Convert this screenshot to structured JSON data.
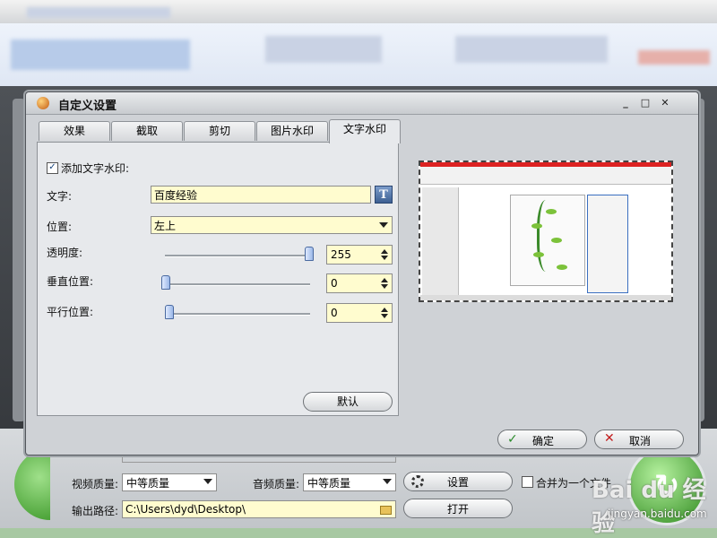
{
  "dialog": {
    "title": "自定义设置",
    "tabs": [
      "效果",
      "截取",
      "剪切",
      "图片水印",
      "文字水印"
    ],
    "active_tab": "文字水印",
    "enable_text_watermark": {
      "label": "添加文字水印:",
      "checked": true
    },
    "text_label": "文字:",
    "text_value": "百度经验",
    "font_button_label": "T",
    "position_label": "位置:",
    "position_value": "左上",
    "opacity_label": "透明度:",
    "opacity_value": "255",
    "vertical_label": "垂直位置:",
    "vertical_value": "0",
    "horizontal_label": "平行位置:",
    "horizontal_value": "0",
    "default_button": "默认",
    "ok_button": "确定",
    "cancel_button": "取消"
  },
  "main_window": {
    "video_quality_label": "视频质量:",
    "video_quality_value": "中等质量",
    "audio_quality_label": "音频质量:",
    "audio_quality_value": "中等质量",
    "output_path_label": "输出路径:",
    "output_path_value": "C:\\Users\\dyd\\Desktop\\",
    "settings_button": "设置",
    "open_button": "打开",
    "merge_label": "合并为一个文件"
  },
  "watermark": {
    "brand": "Bai du 经验",
    "url": "jingyan.baidu.com"
  }
}
